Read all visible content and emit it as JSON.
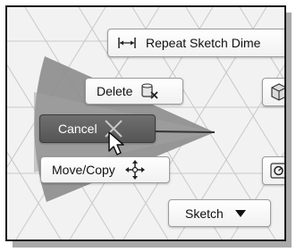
{
  "marking_menu": {
    "repeat": {
      "label": "Repeat Sketch Dime",
      "icon": "dimension-icon"
    },
    "delete": {
      "label": "Delete",
      "icon": "delete-eraser-icon"
    },
    "cancel": {
      "label": "Cancel",
      "icon": "cancel-x-icon",
      "state": "hovered"
    },
    "move_copy": {
      "label": "Move/Copy",
      "icon": "move-arrows-icon"
    },
    "sketch": {
      "label": "Sketch",
      "icon": "dropdown-triangle-icon"
    },
    "partial_right_top": {
      "icon": "component-cube-icon"
    },
    "partial_right_bottom": {
      "icon": "measure-icon"
    }
  },
  "colors": {
    "wedge": "#8c8c8c",
    "hover_button": "#5e5e5e",
    "grid_line": "#c6c6c6",
    "background": "#f2f2f2"
  }
}
